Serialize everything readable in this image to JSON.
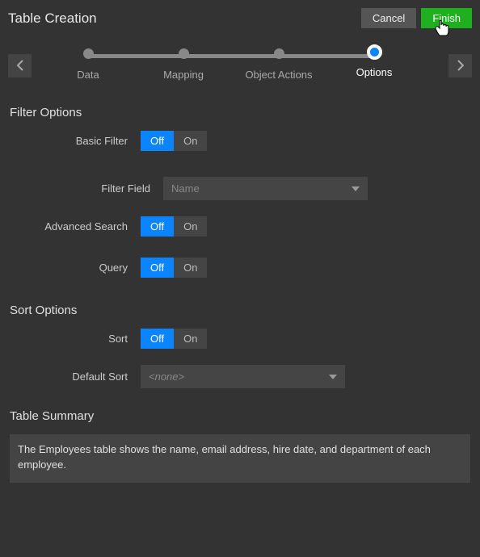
{
  "header": {
    "title": "Table Creation",
    "cancel_label": "Cancel",
    "finish_label": "Finish"
  },
  "wizard": {
    "steps": [
      {
        "label": "Data"
      },
      {
        "label": "Mapping"
      },
      {
        "label": "Object Actions"
      },
      {
        "label": "Options"
      }
    ],
    "active_index": 3
  },
  "filter_options": {
    "section_title": "Filter Options",
    "basic_filter": {
      "label": "Basic Filter",
      "off": "Off",
      "on": "On",
      "value": "Off"
    },
    "filter_field": {
      "label": "Filter Field",
      "value": "Name"
    },
    "advanced_search": {
      "label": "Advanced Search",
      "off": "Off",
      "on": "On",
      "value": "Off"
    },
    "query": {
      "label": "Query",
      "off": "Off",
      "on": "On",
      "value": "Off"
    }
  },
  "sort_options": {
    "section_title": "Sort Options",
    "sort": {
      "label": "Sort",
      "off": "Off",
      "on": "On",
      "value": "Off"
    },
    "default_sort": {
      "label": "Default Sort",
      "value": "<none>"
    }
  },
  "table_summary": {
    "section_title": "Table Summary",
    "text": "The Employees table shows the name, email address, hire date, and department of each employee."
  }
}
